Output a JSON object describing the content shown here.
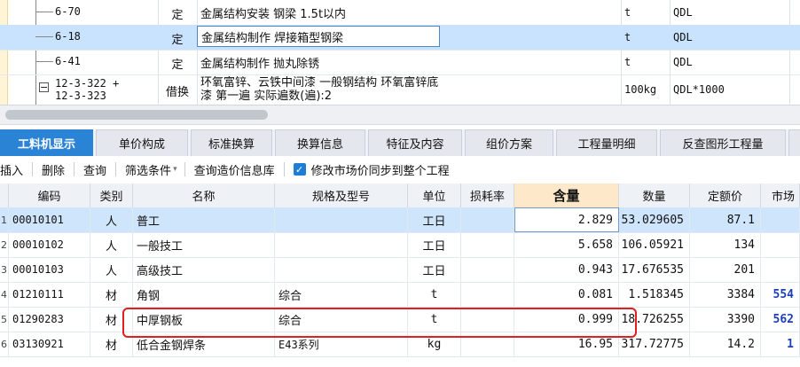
{
  "top_rows": [
    {
      "code": "6-70",
      "type": "定",
      "name": "金属结构安装 钢梁 1.5t以内",
      "unit": "t",
      "qty": "QDL"
    },
    {
      "code": "6-18",
      "type": "定",
      "name": "金属结构制作 焊接箱型钢梁",
      "unit": "t",
      "qty": "QDL"
    },
    {
      "code": "6-41",
      "type": "定",
      "name": "金属结构制作 抛丸除锈",
      "unit": "t",
      "qty": "QDL"
    },
    {
      "code": "12-3-322 +\n12-3-323",
      "type": "借换",
      "name": "环氧富锌、云铁中间漆 一般钢结构 环氧富锌底漆 第一遍  实际遍数(遍):2",
      "unit": "100kg",
      "qty": "QDL*1000"
    }
  ],
  "tabs": [
    "工料机显示",
    "单价构成",
    "标准换算",
    "换算信息",
    "特征及内容",
    "组价方案",
    "工程量明细",
    "反查图形工程量"
  ],
  "toolbar": {
    "insert": "插入",
    "delete": "删除",
    "query": "查询",
    "filter": "筛选条件",
    "query_price": "查询造价信息库",
    "sync_label": "修改市场价同步到整个工程"
  },
  "table": {
    "headers": [
      "编码",
      "类别",
      "名称",
      "规格及型号",
      "单位",
      "损耗率",
      "含量",
      "数量",
      "定额价",
      "市场"
    ],
    "rows": [
      {
        "idx": "1",
        "code": "00010101",
        "cat": "人",
        "name": "普工",
        "spec": "",
        "unit": "工日",
        "loss": "",
        "content": "2.829",
        "qty": "53.029605",
        "price": "87.1",
        "market": ""
      },
      {
        "idx": "2",
        "code": "00010102",
        "cat": "人",
        "name": "一般技工",
        "spec": "",
        "unit": "工日",
        "loss": "",
        "content": "5.658",
        "qty": "106.05921",
        "price": "134",
        "market": ""
      },
      {
        "idx": "3",
        "code": "00010103",
        "cat": "人",
        "name": "高级技工",
        "spec": "",
        "unit": "工日",
        "loss": "",
        "content": "0.943",
        "qty": "17.676535",
        "price": "201",
        "market": ""
      },
      {
        "idx": "4",
        "code": "01210111",
        "cat": "材",
        "name": "角钢",
        "spec": "综合",
        "unit": "t",
        "loss": "",
        "content": "0.081",
        "qty": "1.518345",
        "price": "3384",
        "market": "554"
      },
      {
        "idx": "5",
        "code": "01290283",
        "cat": "材",
        "name": "中厚钢板",
        "spec": "综合",
        "unit": "t",
        "loss": "",
        "content": "0.999",
        "qty": "18.726255",
        "price": "3390",
        "market": "562"
      },
      {
        "idx": "6",
        "code": "03130921",
        "cat": "材",
        "name": "低合金钢焊条",
        "spec": "E43系列",
        "unit": "kg",
        "loss": "",
        "content": "16.95",
        "qty": "317.72775",
        "price": "14.2",
        "market": "1"
      }
    ]
  },
  "colors": {
    "accent": "#2b83d6",
    "selected_row": "#cfe5fb",
    "highlight_header": "#fde9c9",
    "annotation": "#e02020",
    "market_text": "#1c3fb4"
  }
}
